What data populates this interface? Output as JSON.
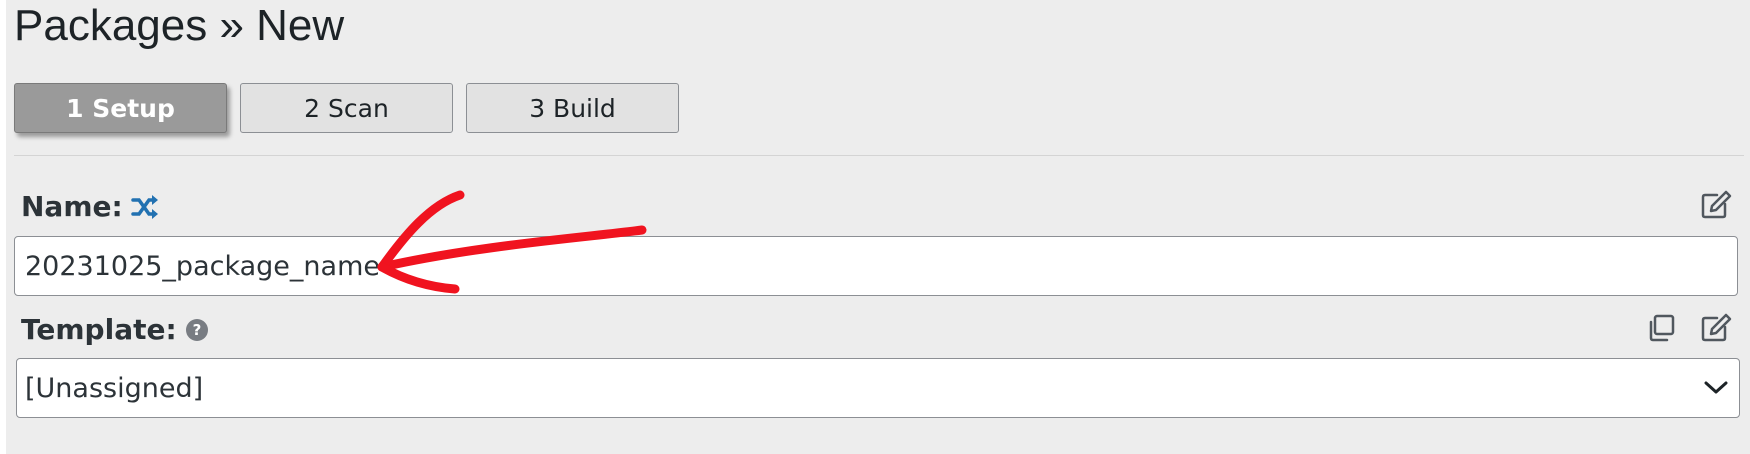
{
  "header": {
    "title": "Packages » New"
  },
  "steps": [
    {
      "label": "1 Setup",
      "active": true
    },
    {
      "label": "2 Scan",
      "active": false
    },
    {
      "label": "3 Build",
      "active": false
    }
  ],
  "name_field": {
    "label": "Name:",
    "value": "20231025_package_name",
    "label_icon": "shuffle-icon",
    "action_icons": [
      "edit-icon"
    ]
  },
  "template_field": {
    "label": "Template:",
    "selected": "[Unassigned]",
    "label_icon": "help-icon",
    "action_icons": [
      "copy-icon",
      "edit-icon"
    ]
  },
  "colors": {
    "annotation_arrow": "#f0131f",
    "shuffle_icon": "#2271b1",
    "active_step": "#9a9a9a"
  }
}
